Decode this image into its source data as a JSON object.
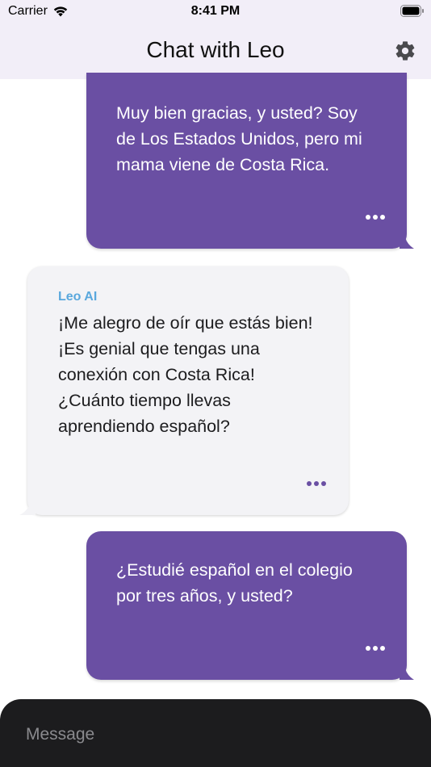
{
  "status_bar": {
    "carrier": "Carrier",
    "time": "8:41 PM"
  },
  "header": {
    "title": "Chat with Leo",
    "settings_icon": "gear-icon"
  },
  "colors": {
    "accent": "#6a4fa3",
    "header_bg": "#f2eef8",
    "ai_bubble_bg": "#f3f3f6",
    "sender_label": "#5aa8dd",
    "composer_bg": "#1c1c1e"
  },
  "messages": [
    {
      "role": "user",
      "text": "Muy bien gracias, y usted? Soy de Los Estados Unidos, pero mi mama viene de Costa Rica."
    },
    {
      "role": "ai",
      "sender": "Leo AI",
      "text": "¡Me alegro de oír que estás bien! ¡Es genial que tengas una conexión con Costa Rica! ¿Cuánto tiempo llevas aprendiendo español?"
    },
    {
      "role": "user",
      "text": "¿Estudié español en el colegio por tres años, y usted?"
    }
  ],
  "composer": {
    "placeholder": "Message"
  }
}
